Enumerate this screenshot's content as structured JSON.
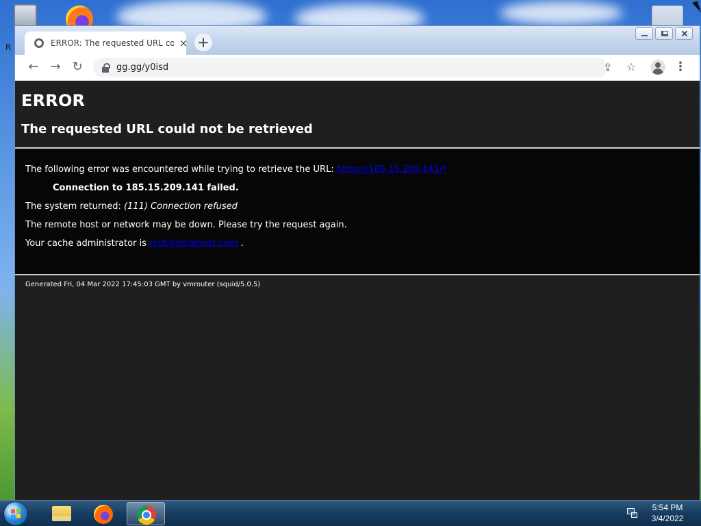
{
  "desktop": {
    "left_letter": "R"
  },
  "browser": {
    "tab": {
      "title": "ERROR: The requested URL could not be retrieved"
    },
    "toolbar": {
      "url": "gg.gg/y0isd"
    }
  },
  "page": {
    "heading": "ERROR",
    "subheading": "The requested URL could not be retrieved",
    "line1_prefix": "The following error was encountered while trying to retrieve the URL:",
    "line1_link": "https://185.15.209.141/*",
    "line2": "Connection to 185.15.209.141 failed.",
    "line3_prefix": "The system returned:",
    "line3_value": "(111) Connection refused",
    "line4": "The remote host or network may be down. Please try the request again.",
    "line5_prefix": "Your cache administrator is",
    "line5_link": "root@localhost.com",
    "line5_suffix": ".",
    "footer": "Generated Fri, 04 Mar 2022 17:45:03 GMT by vmrouter (squid/5.0.5)"
  },
  "taskbar": {
    "time": "5:54 PM",
    "date": "3/4/2022"
  },
  "colors": {
    "page_background": "#1f1f1f",
    "content_background": "#060606",
    "link": "#0000ee",
    "text": "#ffffff"
  },
  "icons": {
    "favicon": "globe-icon",
    "close": "close-icon",
    "new_tab": "plus-icon",
    "back": "arrow-left-icon",
    "forward": "arrow-right-icon",
    "reload": "reload-icon",
    "lock": "lock-icon",
    "share": "share-icon",
    "bookmark": "star-icon",
    "profile": "profile-icon",
    "menu": "more-vertical-icon"
  }
}
